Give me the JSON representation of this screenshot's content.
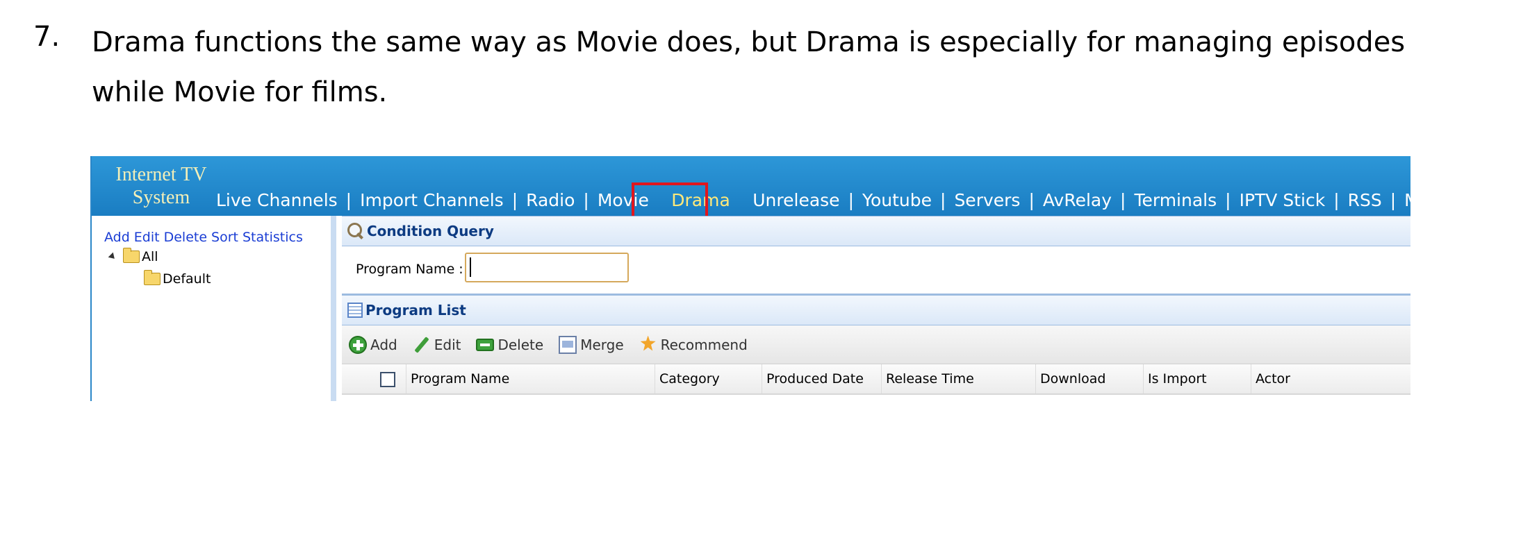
{
  "document": {
    "step_number": "7.",
    "step_text_line1": "Drama functions the same way as Movie does, but Drama is especially for managing episodes",
    "step_text_line2": "while Movie for films."
  },
  "app": {
    "logo_line1": "Internet TV",
    "logo_line2": "System"
  },
  "nav": {
    "items": [
      "Live Channels",
      "Import Channels",
      "Radio",
      "Movie",
      "Drama",
      "Unrelease",
      "Youtube",
      "Servers",
      "AvRelay",
      "Terminals",
      "IPTV Stick",
      "RSS",
      "Music"
    ],
    "separator": "|",
    "active": "Drama"
  },
  "tree": {
    "actions": [
      "Add",
      "Edit",
      "Delete",
      "Sort",
      "Statistics"
    ],
    "root": "All",
    "children": [
      "Default"
    ]
  },
  "condition_query": {
    "title": "Condition Query",
    "program_name_label": "Program Name :",
    "program_name_value": ""
  },
  "program_list": {
    "title": "Program List",
    "toolbar": [
      "Add",
      "Edit",
      "Delete",
      "Merge",
      "Recommend"
    ],
    "columns": [
      "Program Name",
      "Category",
      "Produced Date",
      "Release Time",
      "Download",
      "Is Import",
      "Actor"
    ]
  },
  "colors": {
    "header_blue": "#1a7dc2",
    "active_nav": "#ffe97a",
    "highlight_red": "#e0161e",
    "link_blue": "#1a3dd4"
  }
}
